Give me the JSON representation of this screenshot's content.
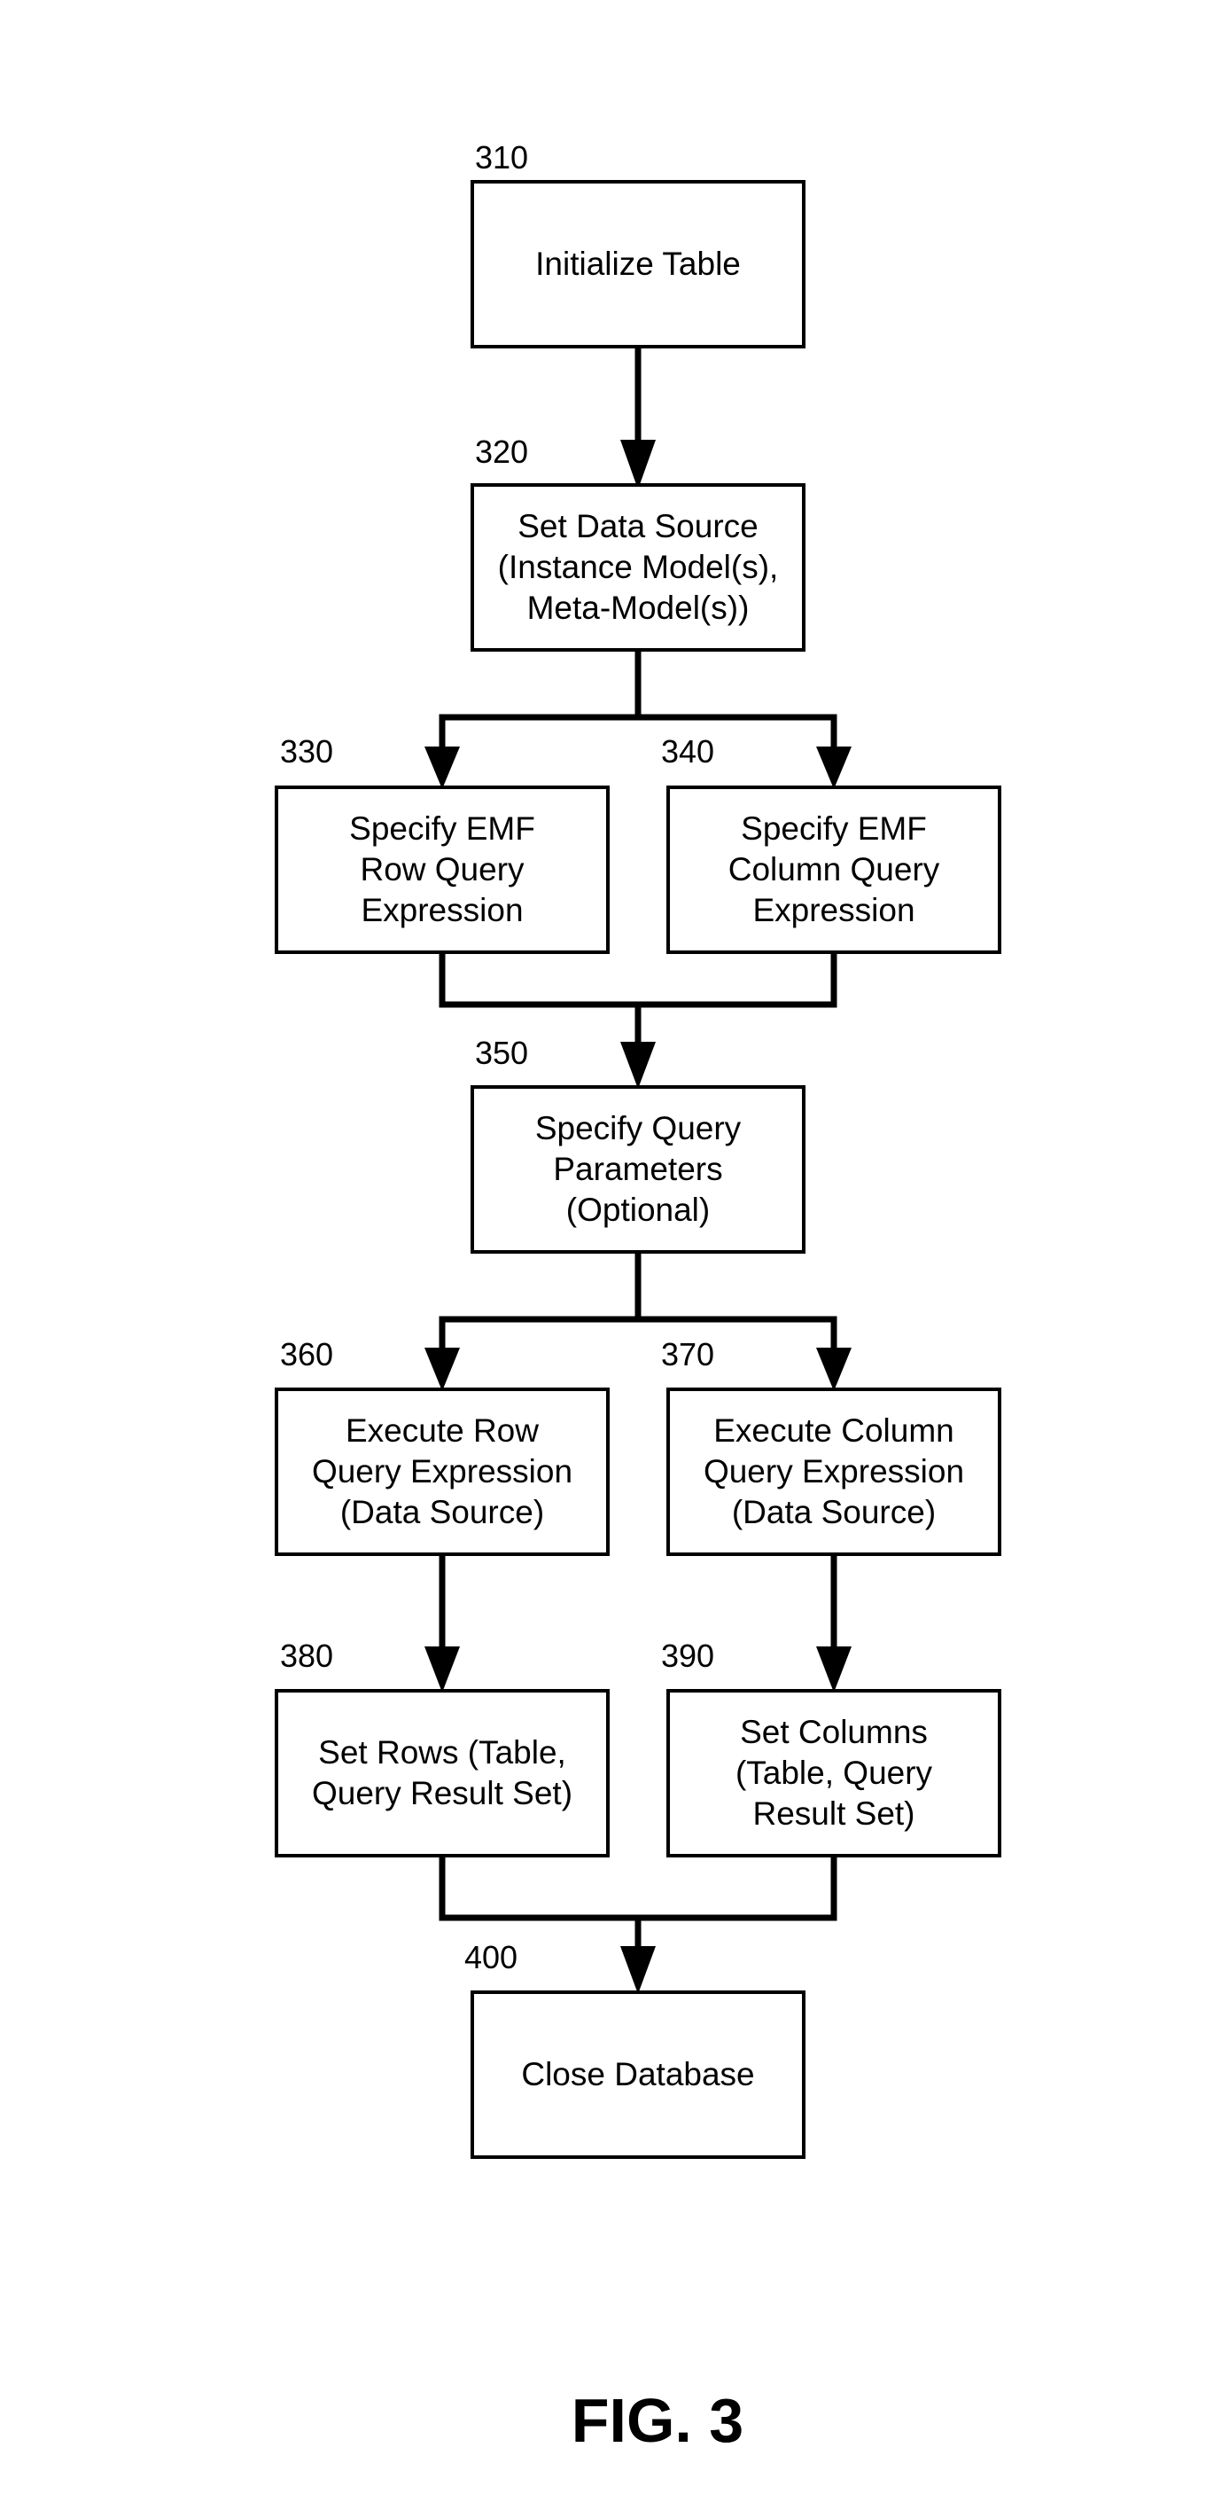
{
  "figure_caption": "FIG. 3",
  "steps": {
    "s310": {
      "ref": "310",
      "text": "Initialize Table"
    },
    "s320": {
      "ref": "320",
      "text": "Set Data Source\n(Instance Model(s),\nMeta-Model(s))"
    },
    "s330": {
      "ref": "330",
      "text": "Specify EMF\nRow Query\nExpression"
    },
    "s340": {
      "ref": "340",
      "text": "Specify EMF\nColumn Query\nExpression"
    },
    "s350": {
      "ref": "350",
      "text": "Specify Query\nParameters\n(Optional)"
    },
    "s360": {
      "ref": "360",
      "text": "Execute Row\nQuery Expression\n(Data Source)"
    },
    "s370": {
      "ref": "370",
      "text": "Execute Column\nQuery Expression\n(Data Source)"
    },
    "s380": {
      "ref": "380",
      "text": "Set Rows (Table,\nQuery Result Set)"
    },
    "s390": {
      "ref": "390",
      "text": "Set Columns\n(Table, Query\nResult Set)"
    },
    "s400": {
      "ref": "400",
      "text": "Close Database"
    }
  },
  "edges": [
    [
      "310",
      "320"
    ],
    [
      "320",
      "330"
    ],
    [
      "320",
      "340"
    ],
    [
      "330",
      "350"
    ],
    [
      "340",
      "350"
    ],
    [
      "350",
      "360"
    ],
    [
      "350",
      "370"
    ],
    [
      "360",
      "380"
    ],
    [
      "370",
      "390"
    ],
    [
      "380",
      "400"
    ],
    [
      "390",
      "400"
    ]
  ]
}
